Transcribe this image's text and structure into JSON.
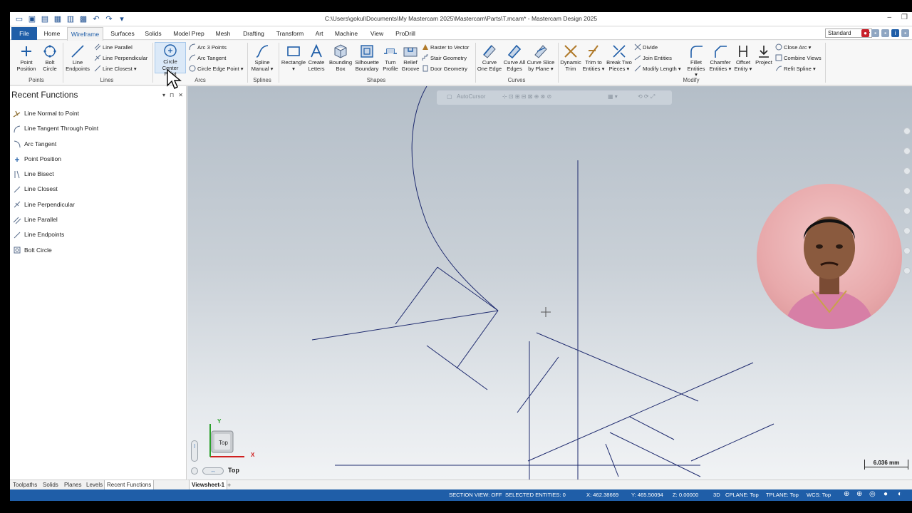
{
  "window": {
    "title": "C:\\Users\\gokul\\Documents\\My Mastercam 2025\\Mastercam\\Parts\\T.mcam* - Mastercam Design 2025"
  },
  "menu": {
    "tabs": [
      "File",
      "Home",
      "Wireframe",
      "Surfaces",
      "Solids",
      "Model Prep",
      "Mesh",
      "Drafting",
      "Transform",
      "Art",
      "Machine",
      "View",
      "ProDrill"
    ],
    "active": "Wireframe",
    "standard": "Standard"
  },
  "ribbon": {
    "points": {
      "point_position": [
        "Point",
        "Position"
      ],
      "bolt_circle": [
        "Bolt",
        "Circle"
      ],
      "label": "Points"
    },
    "lines": {
      "line_endpoints": [
        "Line",
        "Endpoints"
      ],
      "line_parallel": "Line Parallel",
      "line_perpendicular": "Line Perpendicular",
      "line_closest": "Line Closest",
      "label": "Lines"
    },
    "arcs": {
      "circle_center_point": [
        "Circle",
        "Center Point"
      ],
      "arc_3_points": "Arc 3 Points",
      "arc_tangent": "Arc Tangent",
      "circle_edge_point": "Circle Edge Point",
      "label": "Arcs"
    },
    "splines": {
      "spline_manual": [
        "Spline",
        "Manual"
      ],
      "label": "Splines"
    },
    "shapes": {
      "rectangle": "Rectangle",
      "create_letters": [
        "Create",
        "Letters"
      ],
      "bounding_box": [
        "Bounding",
        "Box"
      ],
      "silhouette_boundary": [
        "Silhouette",
        "Boundary"
      ],
      "turn_profile": [
        "Turn",
        "Profile"
      ],
      "relief_groove": [
        "Relief",
        "Groove"
      ],
      "raster_to_vector": "Raster to Vector",
      "stair_geometry": "Stair Geometry",
      "door_geometry": "Door Geometry",
      "label": "Shapes"
    },
    "curves": {
      "curve_one_edge": [
        "Curve",
        "One Edge"
      ],
      "curve_all_edges": [
        "Curve All",
        "Edges"
      ],
      "curve_slice": [
        "Curve Slice",
        "by Plane"
      ],
      "label": "Curves"
    },
    "modify": {
      "dynamic_trim": [
        "Dynamic",
        "Trim"
      ],
      "trim_to_entities": [
        "Trim to",
        "Entities"
      ],
      "break_two_pieces": [
        "Break Two",
        "Pieces"
      ],
      "divide": "Divide",
      "join_entities": "Join Entities",
      "modify_length": "Modify Length",
      "fillet_entities": [
        "Fillet",
        "Entities"
      ],
      "chamfer_entities": [
        "Chamfer",
        "Entities"
      ],
      "offset_entity": [
        "Offset",
        "Entity"
      ],
      "project": "Project",
      "close_arc": "Close Arc",
      "combine_views": "Combine Views",
      "refit_spline": "Refit Spline",
      "label": "Modify"
    }
  },
  "recent_functions": {
    "title": "Recent Functions",
    "items": [
      "Line Normal to Point",
      "Line Tangent Through Point",
      "Arc Tangent",
      "Point Position",
      "Line Bisect",
      "Line Closest",
      "Line Perpendicular",
      "Line Parallel",
      "Line Endpoints",
      "Bolt Circle"
    ]
  },
  "manager_tabs": [
    "Toolpaths",
    "Solids",
    "Planes",
    "Levels",
    "Recent Functions"
  ],
  "viewport": {
    "autocursor": "AutoCursor",
    "view_name": "Top",
    "cube_label": "Top",
    "axis_x": "X",
    "axis_y": "Y",
    "scale": "6.036 mm"
  },
  "viewsheet": {
    "tab": "Viewsheet-1",
    "add": "+"
  },
  "status": {
    "section_view": "SECTION VIEW: OFF",
    "selected": "SELECTED ENTITIES: 0",
    "x": "X:  462.38669",
    "y": "Y:  465.50094",
    "z": "Z:  0.00000",
    "mode": "3D",
    "cplane": "CPLANE: Top",
    "tplane": "TPLANE: Top",
    "wcs": "WCS: Top"
  },
  "colors": {
    "accent": "#1f5ea8",
    "geometry": "#1e2a6e"
  }
}
